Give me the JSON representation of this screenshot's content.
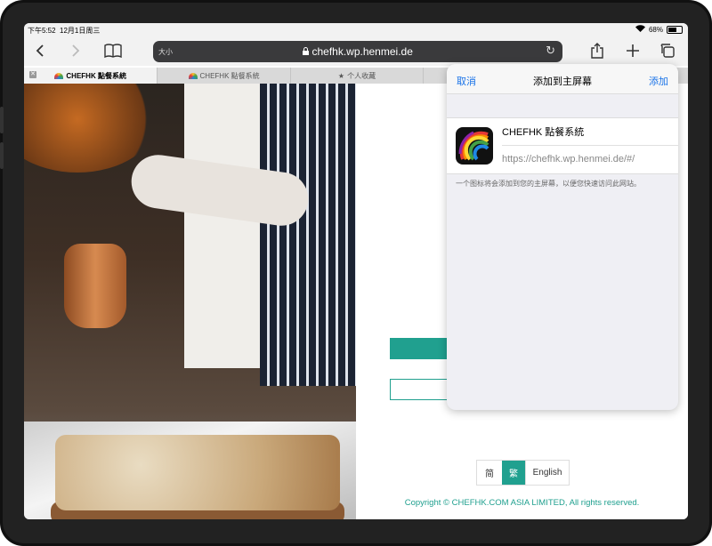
{
  "status": {
    "time": "下午5:52",
    "date": "12月1日周三",
    "battery": "68%",
    "battery_level": 0.68
  },
  "toolbar": {
    "text_size": "大小",
    "url": "chefhk.wp.henmei.de"
  },
  "tabs": [
    {
      "label": "CHEFHK 點餐系統"
    },
    {
      "label": "CHEFHK 點餐系統"
    },
    {
      "label": "个人收藏"
    },
    {
      "label": ""
    }
  ],
  "share_sheet": {
    "cancel": "取消",
    "title": "添加到主屏幕",
    "add": "添加",
    "app_name": "CHEFHK 點餐系統",
    "app_url": "https://chefhk.wp.henmei.de/#/",
    "hint": "一个图标将会添加到您的主屏幕，以便您快速访问此网站。"
  },
  "page": {
    "lang_simplified": "简",
    "lang_traditional": "繁",
    "lang_english": "English",
    "copyright": "Copyright © CHEFHK.COM ASIA LIMITED, All rights reserved."
  },
  "colors": {
    "accent": "#20a08f",
    "link_blue": "#1a73e8"
  }
}
